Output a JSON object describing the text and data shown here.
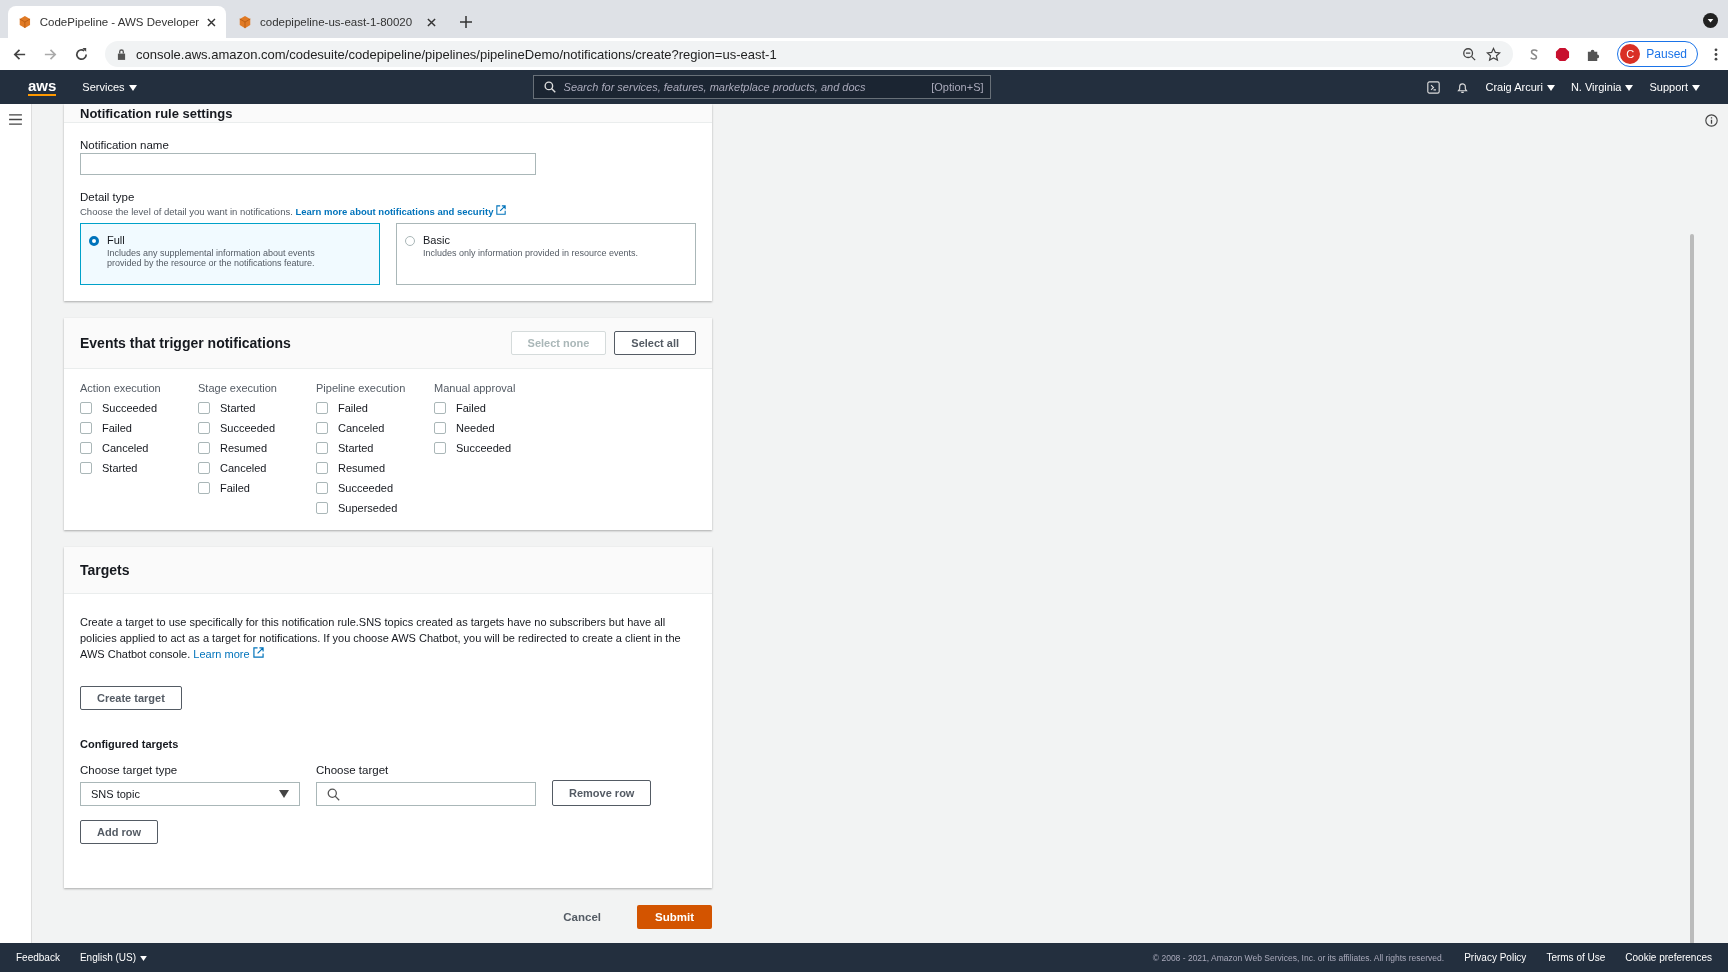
{
  "browser": {
    "tabs": [
      {
        "title": "CodePipeline - AWS Developer",
        "selected": true
      },
      {
        "title": "codepipeline-us-east-1-80020",
        "selected": false
      }
    ],
    "url": "console.aws.amazon.com/codesuite/codepipeline/pipelines/pipelineDemo/notifications/create?region=us-east-1",
    "profile_initial": "C",
    "profile_label": "Paused"
  },
  "aws_nav": {
    "logo": "aws",
    "services": "Services",
    "search_placeholder": "Search for services, features, marketplace products, and docs",
    "shortcut": "[Option+S]",
    "user": "Craig Arcuri",
    "region": "N. Virginia",
    "support": "Support"
  },
  "settings": {
    "title": "Notification rule settings",
    "name_label": "Notification name",
    "detail_label": "Detail type",
    "detail_description": "Choose the level of detail you want in notifications.",
    "detail_link": "Learn more about notifications and security",
    "options": [
      {
        "title": "Full",
        "description": "Includes any supplemental information about events provided by the resource or the notifications feature.",
        "selected": true
      },
      {
        "title": "Basic",
        "description": "Includes only information provided in resource events.",
        "selected": false
      }
    ]
  },
  "events": {
    "title": "Events that trigger notifications",
    "buttons": [
      {
        "label": "Select none",
        "disabled": true
      },
      {
        "label": "Select all",
        "disabled": false
      }
    ],
    "groups": [
      {
        "title": "Action execution",
        "items": [
          {
            "label": "Succeeded",
            "checked": false
          },
          {
            "label": "Failed",
            "checked": false
          },
          {
            "label": "Canceled",
            "checked": false
          },
          {
            "label": "Started",
            "checked": false
          }
        ]
      },
      {
        "title": "Stage execution",
        "items": [
          {
            "label": "Started",
            "checked": false
          },
          {
            "label": "Succeeded",
            "checked": false
          },
          {
            "label": "Resumed",
            "checked": false
          },
          {
            "label": "Canceled",
            "checked": false
          },
          {
            "label": "Failed",
            "checked": false
          }
        ]
      },
      {
        "title": "Pipeline execution",
        "items": [
          {
            "label": "Failed",
            "checked": false
          },
          {
            "label": "Canceled",
            "checked": false
          },
          {
            "label": "Started",
            "checked": false
          },
          {
            "label": "Resumed",
            "checked": false
          },
          {
            "label": "Succeeded",
            "checked": false
          },
          {
            "label": "Superseded",
            "checked": false
          }
        ]
      },
      {
        "title": "Manual approval",
        "items": [
          {
            "label": "Failed",
            "checked": false
          },
          {
            "label": "Needed",
            "checked": false
          },
          {
            "label": "Succeeded",
            "checked": false
          }
        ]
      }
    ]
  },
  "targets": {
    "title": "Targets",
    "description": "Create a target to use specifically for this notification rule.SNS topics created as targets have no subscribers but have all policies applied to act as a target for notifications. If you choose AWS Chatbot, you will be redirected to create a client in the AWS Chatbot console.",
    "link": "Learn more",
    "create_button": "Create target",
    "configured_title": "Configured targets",
    "type_label": "Choose target type",
    "type_value": "SNS topic",
    "target_label": "Choose target",
    "remove_button": "Remove row",
    "add_button": "Add row"
  },
  "actions": {
    "cancel": "Cancel",
    "submit": "Submit"
  },
  "footer": {
    "feedback": "Feedback",
    "language": "English (US)",
    "copyright": "© 2008 - 2021, Amazon Web Services, Inc. or its affiliates. All rights reserved.",
    "links": [
      "Privacy Policy",
      "Terms of Use",
      "Cookie preferences"
    ]
  }
}
